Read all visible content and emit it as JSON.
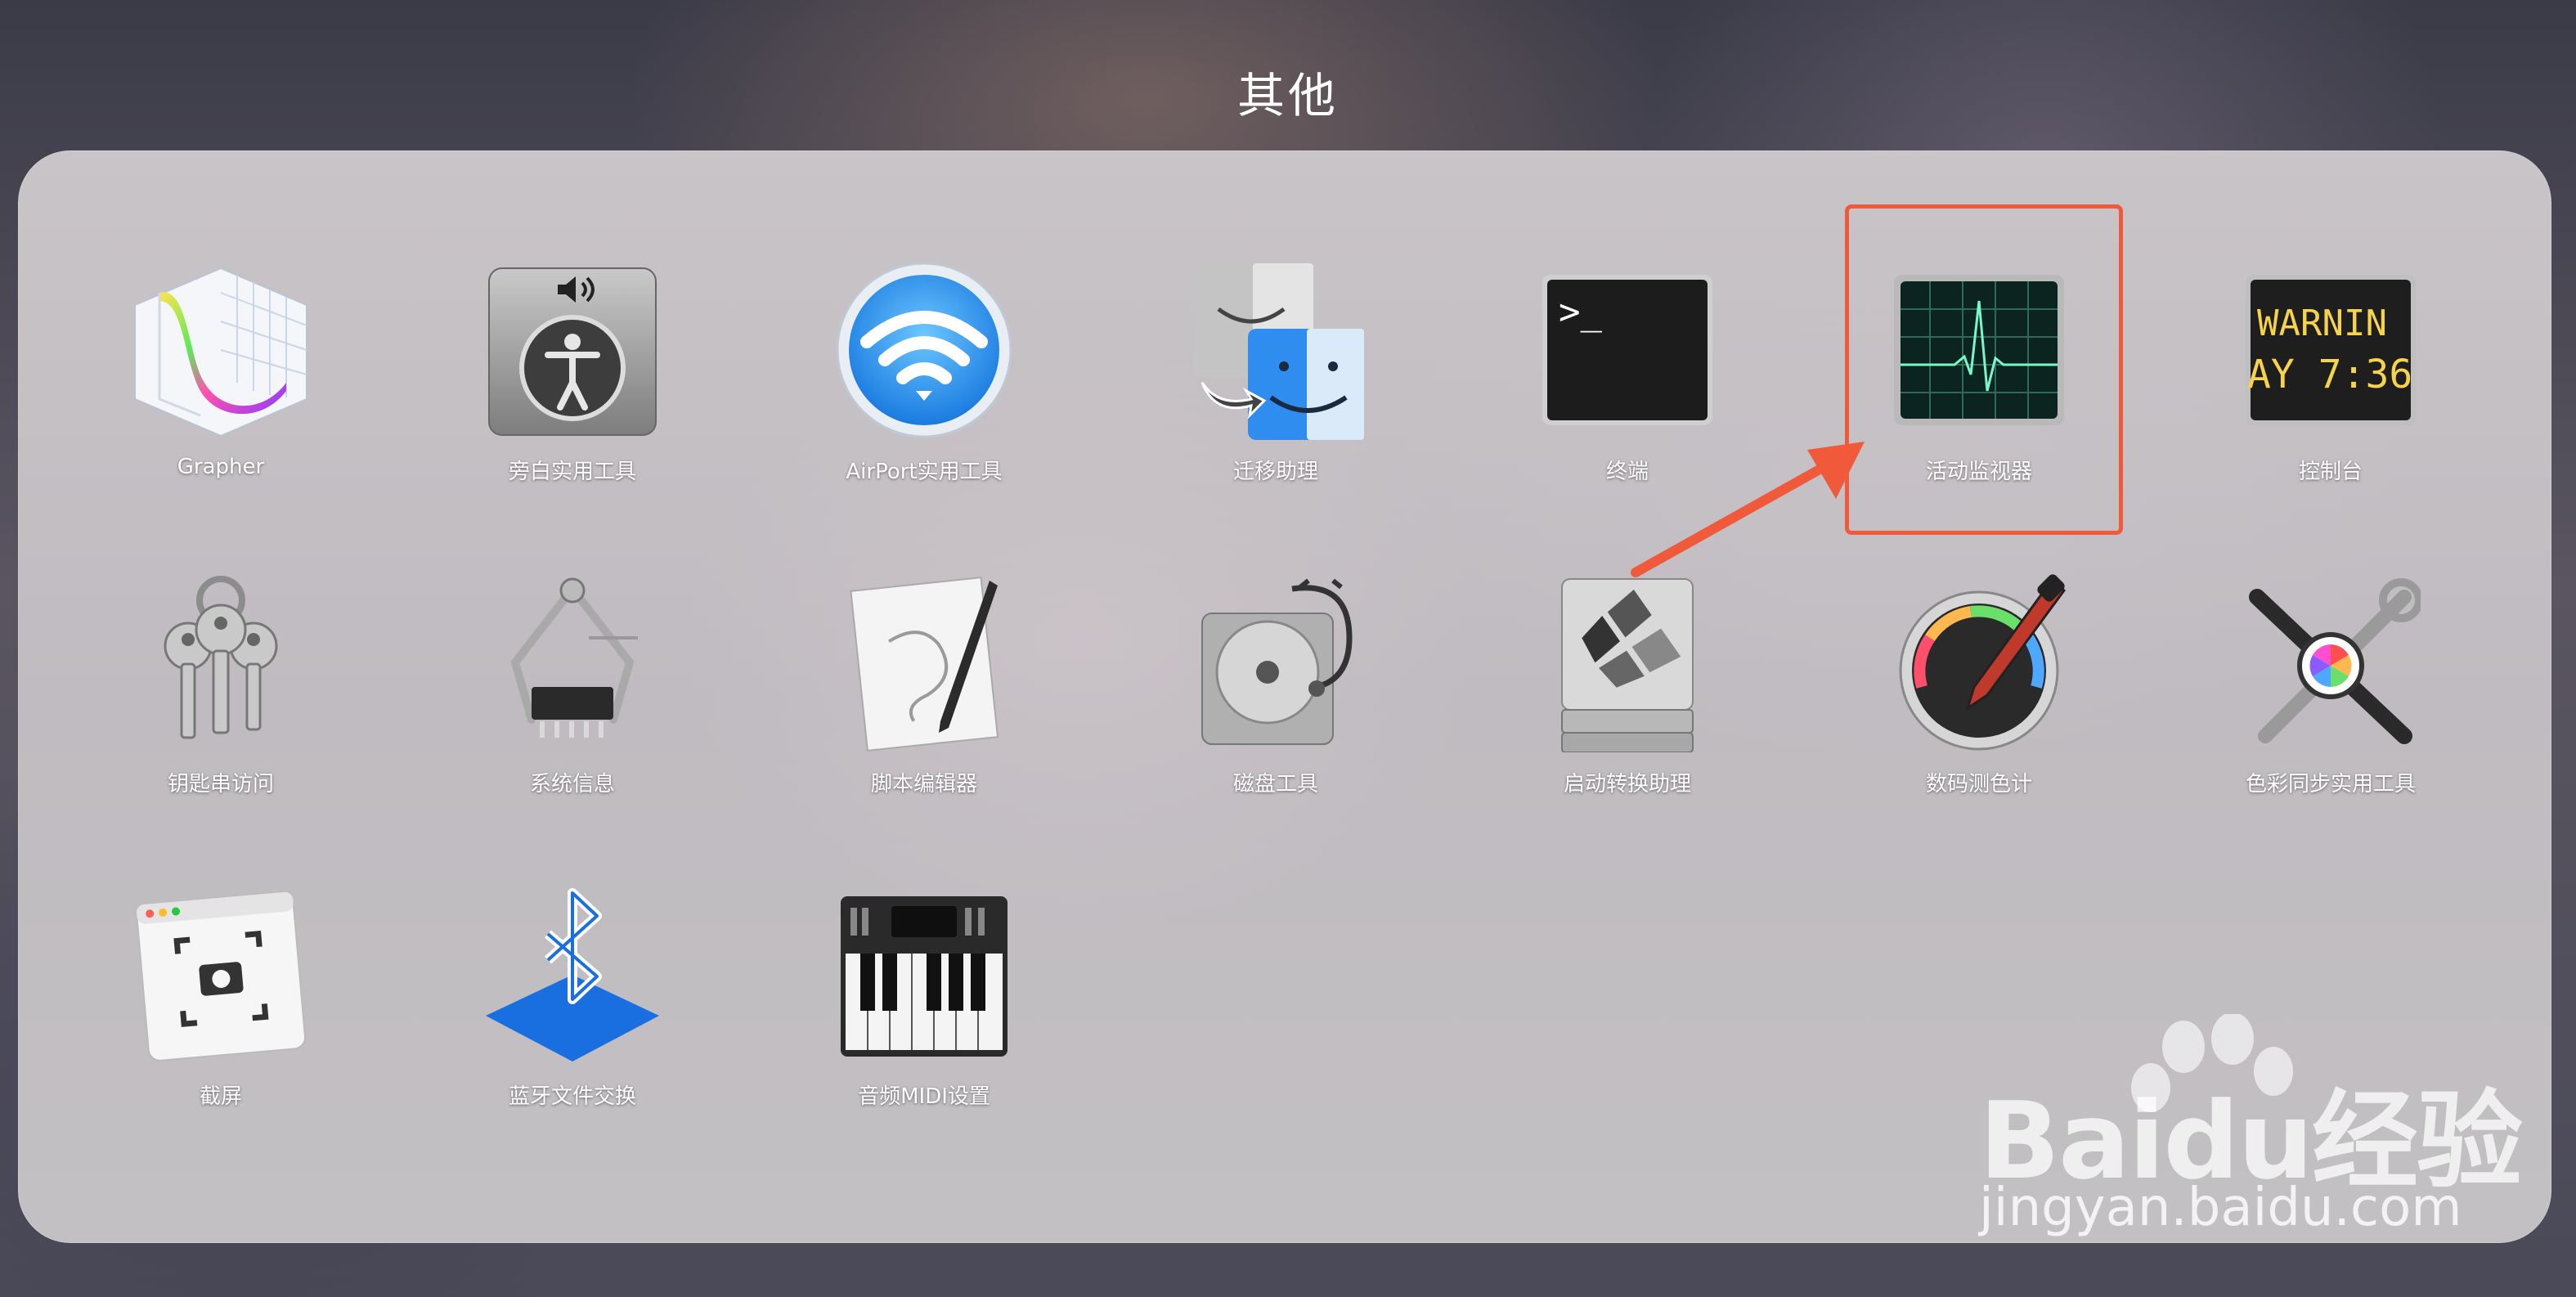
{
  "folder": {
    "title": "其他"
  },
  "apps": [
    {
      "label": "Grapher",
      "icon": "grapher-icon"
    },
    {
      "label": "旁白实用工具",
      "icon": "voiceover-utility-icon"
    },
    {
      "label": "AirPort实用工具",
      "icon": "airport-utility-icon"
    },
    {
      "label": "迁移助理",
      "icon": "migration-assistant-icon"
    },
    {
      "label": "终端",
      "icon": "terminal-icon"
    },
    {
      "label": "活动监视器",
      "icon": "activity-monitor-icon"
    },
    {
      "label": "控制台",
      "icon": "console-icon"
    },
    {
      "label": "钥匙串访问",
      "icon": "keychain-access-icon"
    },
    {
      "label": "系统信息",
      "icon": "system-information-icon"
    },
    {
      "label": "脚本编辑器",
      "icon": "script-editor-icon"
    },
    {
      "label": "磁盘工具",
      "icon": "disk-utility-icon"
    },
    {
      "label": "启动转换助理",
      "icon": "boot-camp-assistant-icon"
    },
    {
      "label": "数码测色计",
      "icon": "digital-color-meter-icon"
    },
    {
      "label": "色彩同步实用工具",
      "icon": "colorsync-utility-icon"
    },
    {
      "label": "截屏",
      "icon": "screenshot-icon"
    },
    {
      "label": "蓝牙文件交换",
      "icon": "bluetooth-file-exchange-icon"
    },
    {
      "label": "音频MIDI设置",
      "icon": "audio-midi-setup-icon"
    }
  ],
  "terminal_icon_text": ">_",
  "console_icon_text": [
    "WARNIN",
    "AY 7:36"
  ],
  "watermark": {
    "brand": "Baidu经验",
    "url": "jingyan.baidu.com"
  },
  "colors": {
    "highlight": "#f05a3a",
    "arrow": "#f05a3a"
  }
}
